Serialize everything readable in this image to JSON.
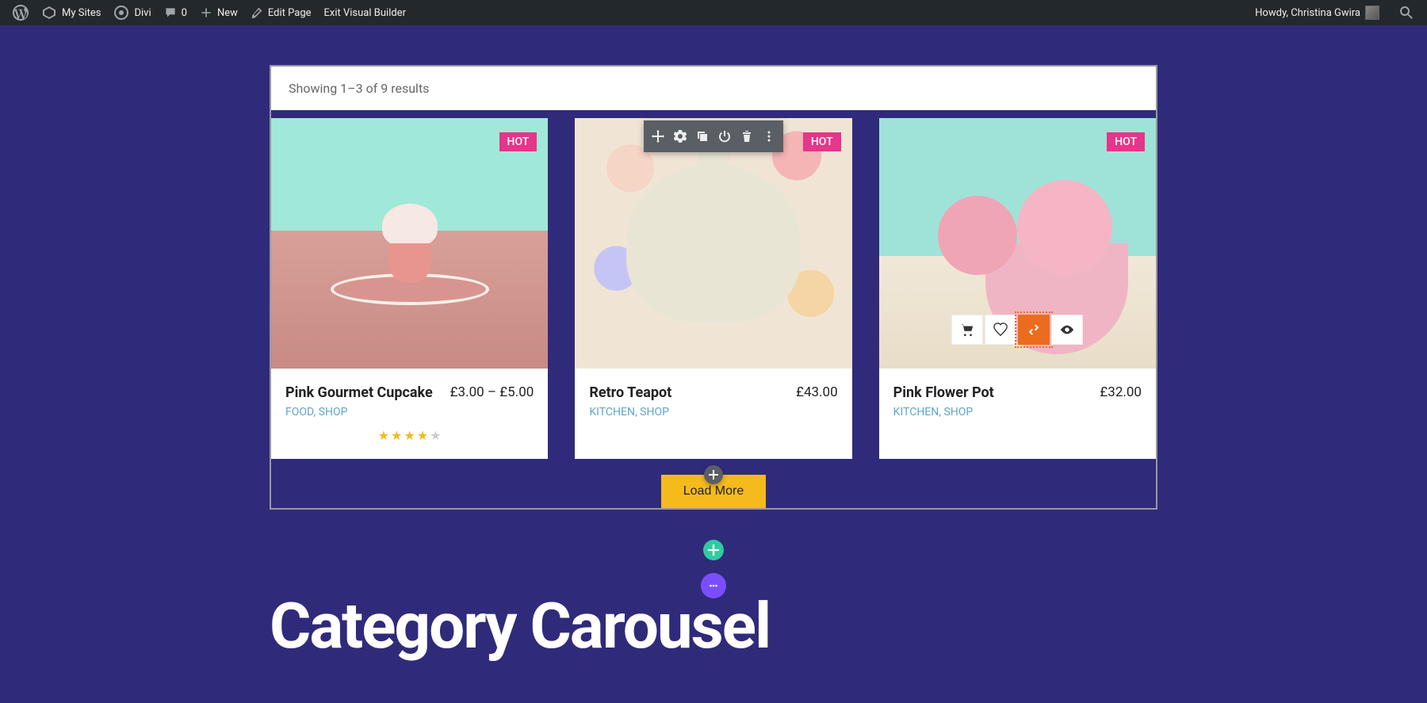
{
  "admin": {
    "mysites": "My Sites",
    "divi": "Divi",
    "comments": "0",
    "new": "New",
    "editpage": "Edit Page",
    "exitvb": "Exit Visual Builder",
    "howdy": "Howdy, Christina Gwira"
  },
  "results_text": "Showing 1–3 of 9 results",
  "hot_label": "HOT",
  "products": [
    {
      "title": "Pink Gourmet Cupcake",
      "price": "£3.00 – £5.00",
      "cat1": "FOOD",
      "cat2": "SHOP",
      "sep": ", ",
      "rating": 4
    },
    {
      "title": "Retro Teapot",
      "price": "£43.00",
      "cat1": "KITCHEN",
      "cat2": "SHOP",
      "sep": ", "
    },
    {
      "title": "Pink Flower Pot",
      "price": "£32.00",
      "cat1": "KITCHEN",
      "cat2": "SHOP",
      "sep": ", "
    }
  ],
  "load_more": "Load More",
  "heading": "Category Carousel"
}
